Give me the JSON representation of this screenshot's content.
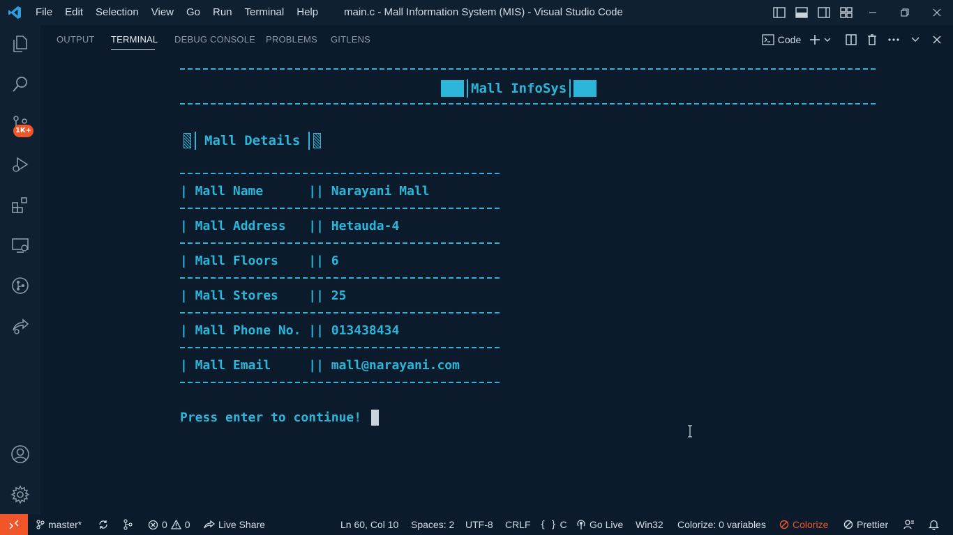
{
  "window": {
    "title": "main.c - Mall Information System (MIS) - Visual Studio Code",
    "menu": [
      "File",
      "Edit",
      "Selection",
      "View",
      "Go",
      "Run",
      "Terminal",
      "Help"
    ]
  },
  "activity_bar": {
    "items": [
      "explorer-icon",
      "search-icon",
      "source-control-icon",
      "run-debug-icon",
      "extensions-icon",
      "remote-explorer-icon",
      "gitlens-icon",
      "live-share-icon"
    ],
    "source_control_badge": "1K+",
    "bottom": [
      "accounts-icon",
      "settings-gear-icon"
    ]
  },
  "panel": {
    "tabs": [
      {
        "label": "OUTPUT",
        "active": false
      },
      {
        "label": "TERMINAL",
        "active": true
      },
      {
        "label": "DEBUG CONSOLE",
        "active": false
      },
      {
        "label": "PROBLEMS",
        "active": false
      },
      {
        "label": "GITLENS",
        "active": false
      }
    ],
    "terminal_profile": "Code"
  },
  "terminal": {
    "app_title": "Mall InfoSys",
    "section_title": "Mall Details",
    "rows": [
      {
        "label": "| Mall Name      || ",
        "value": "Narayani Mall"
      },
      {
        "label": "| Mall Address   || ",
        "value": "Hetauda-4"
      },
      {
        "label": "| Mall Floors    || ",
        "value": "6"
      },
      {
        "label": "| Mall Stores    || ",
        "value": "25"
      },
      {
        "label": "| Mall Phone No. || ",
        "value": "013438434"
      },
      {
        "label": "| Mall Email     || ",
        "value": "mall@narayani.com"
      }
    ],
    "prompt": "Press enter to continue!",
    "text_color": "#2bb5d8"
  },
  "status_bar": {
    "branch": "master*",
    "errors": "0",
    "warnings": "0",
    "live_share": "Live Share",
    "cursor_pos": "Ln 60, Col 10",
    "spaces": "Spaces: 2",
    "encoding": "UTF-8",
    "eol": "CRLF",
    "language": "C",
    "go_live": "Go Live",
    "platform": "Win32",
    "colorize_vars": "Colorize: 0 variables",
    "colorize": "Colorize",
    "prettier": "Prettier",
    "accent_color": "#f0562a"
  }
}
